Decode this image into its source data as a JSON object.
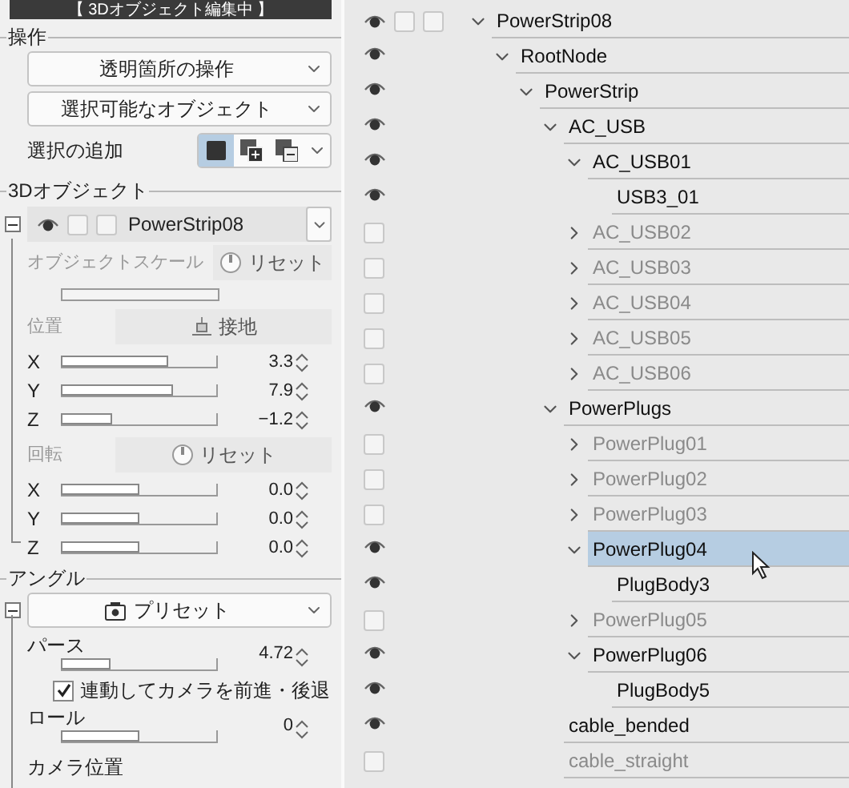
{
  "title": "【 3Dオブジェクト編集中 】",
  "operation": {
    "label": "操作",
    "dropdowns": [
      "透明箇所の操作",
      "選択可能なオブジェクト"
    ],
    "selection_add": {
      "label": "選択の追加",
      "modes": [
        {
          "kind": "new",
          "selected": true
        },
        {
          "kind": "add",
          "selected": false
        },
        {
          "kind": "subtract",
          "selected": false
        }
      ]
    }
  },
  "object": {
    "label": "3Dオブジェクト",
    "expanded": true,
    "visible": true,
    "checks": [
      false,
      false
    ],
    "name": "PowerStrip08",
    "scale": {
      "label": "オブジェクトスケール",
      "button": "リセット"
    },
    "position": {
      "label": "位置",
      "button": "接地",
      "axes": [
        {
          "axis": "X",
          "level": 0.69,
          "value": "3.3"
        },
        {
          "axis": "Y",
          "level": 0.72,
          "value": "7.9"
        },
        {
          "axis": "Z",
          "level": 0.33,
          "value": "−1.2"
        }
      ]
    },
    "rotation": {
      "label": "回転",
      "button": "リセット",
      "axes": [
        {
          "axis": "X",
          "level": 0.5,
          "value": "0.0"
        },
        {
          "axis": "Y",
          "level": 0.5,
          "value": "0.0"
        },
        {
          "axis": "Z",
          "level": 0.5,
          "value": "0.0"
        }
      ]
    }
  },
  "angle": {
    "label": "アングル",
    "expanded": true,
    "preset": "プリセット",
    "perspective": {
      "label": "パース",
      "level": 0.32,
      "value": "4.72"
    },
    "link_camera": {
      "label": "連動してカメラを前進・後退",
      "checked": true
    },
    "roll": {
      "label": "ロール",
      "level": 0.5,
      "value": "0"
    },
    "camera_position": {
      "label": "カメラ位置"
    }
  },
  "tree": {
    "checks": [
      false,
      false
    ],
    "nodes": [
      {
        "name": "PowerStrip08",
        "visible": true,
        "expanded": true,
        "selected": false,
        "children": [
          {
            "name": "RootNode",
            "visible": true,
            "expanded": true,
            "selected": false,
            "children": [
              {
                "name": "PowerStrip",
                "visible": true,
                "expanded": true,
                "selected": false,
                "children": [
                  {
                    "name": "AC_USB",
                    "visible": true,
                    "expanded": true,
                    "selected": false,
                    "children": [
                      {
                        "name": "AC_USB01",
                        "visible": true,
                        "expanded": true,
                        "selected": false,
                        "children": [
                          {
                            "name": "USB3_01",
                            "visible": true,
                            "selected": false
                          }
                        ]
                      },
                      {
                        "name": "AC_USB02",
                        "visible": false,
                        "expanded": false,
                        "selected": false
                      },
                      {
                        "name": "AC_USB03",
                        "visible": false,
                        "expanded": false,
                        "selected": false
                      },
                      {
                        "name": "AC_USB04",
                        "visible": false,
                        "expanded": false,
                        "selected": false
                      },
                      {
                        "name": "AC_USB05",
                        "visible": false,
                        "expanded": false,
                        "selected": false
                      },
                      {
                        "name": "AC_USB06",
                        "visible": false,
                        "expanded": false,
                        "selected": false
                      }
                    ]
                  },
                  {
                    "name": "PowerPlugs",
                    "visible": true,
                    "expanded": true,
                    "selected": false,
                    "children": [
                      {
                        "name": "PowerPlug01",
                        "visible": false,
                        "expanded": false,
                        "selected": false
                      },
                      {
                        "name": "PowerPlug02",
                        "visible": false,
                        "expanded": false,
                        "selected": false
                      },
                      {
                        "name": "PowerPlug03",
                        "visible": false,
                        "expanded": false,
                        "selected": false
                      },
                      {
                        "name": "PowerPlug04",
                        "visible": true,
                        "expanded": true,
                        "selected": true,
                        "children": [
                          {
                            "name": "PlugBody3",
                            "visible": true,
                            "selected": false
                          }
                        ]
                      },
                      {
                        "name": "PowerPlug05",
                        "visible": false,
                        "expanded": false,
                        "selected": false
                      },
                      {
                        "name": "PowerPlug06",
                        "visible": true,
                        "expanded": true,
                        "selected": false,
                        "children": [
                          {
                            "name": "PlugBody5",
                            "visible": true,
                            "selected": false
                          }
                        ]
                      }
                    ]
                  },
                  {
                    "name": "cable_bended",
                    "visible": true,
                    "selected": false
                  },
                  {
                    "name": "cable_straight",
                    "visible": false,
                    "selected": false
                  }
                ]
              }
            ]
          }
        ]
      }
    ]
  }
}
